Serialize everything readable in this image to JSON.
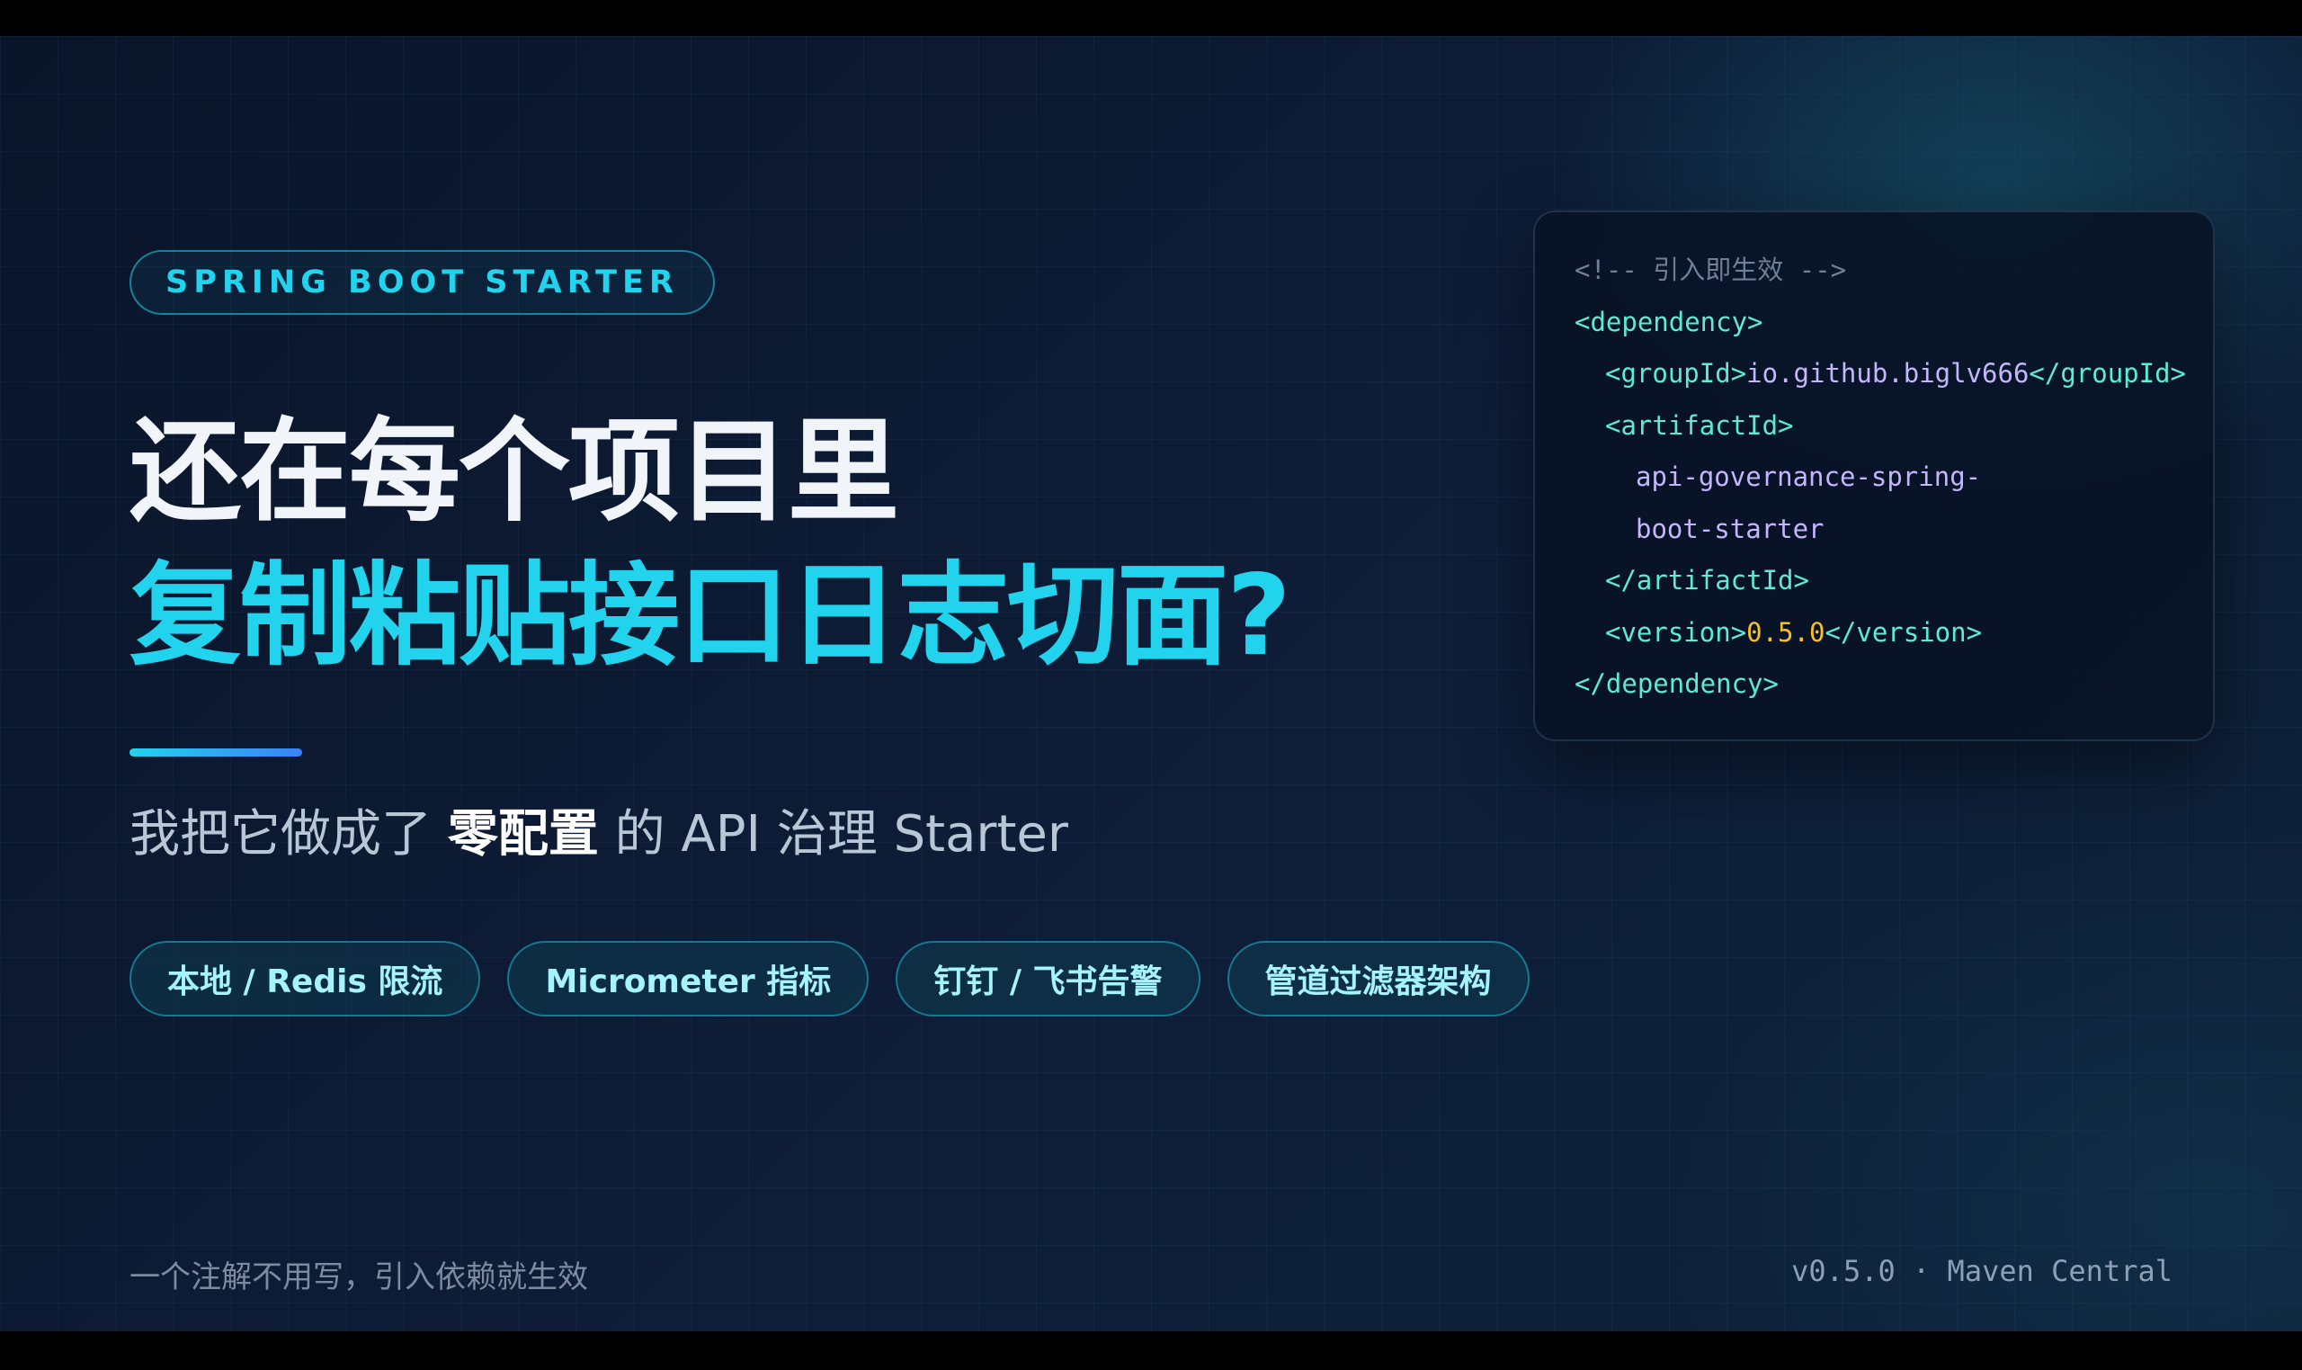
{
  "eyebrow": "SPRING BOOT STARTER",
  "headline": {
    "line1": "还在每个项目里",
    "line2": "复制粘贴接口日志切面?"
  },
  "subtitle": {
    "prefix": "我把它做成了 ",
    "emphasis": "零配置",
    "suffix": " 的 API 治理 Starter"
  },
  "pills": [
    "本地 / Redis 限流",
    "Micrometer 指标",
    "钉钉 / 飞书告警",
    "管道过滤器架构"
  ],
  "code": {
    "comment": "<!-- 引入即生效 -->",
    "dependency_open": "<dependency>",
    "group_open": "<groupId>",
    "group_value": "io.github.biglv666",
    "group_close": "</groupId>",
    "artifact_open": "<artifactId>",
    "artifact_value_line1": "api-governance-spring-",
    "artifact_value_line2": "boot-starter",
    "artifact_close": "</artifactId>",
    "version_open": "<version>",
    "version_value": "0.5.0",
    "version_close": "</version>",
    "dependency_close": "</dependency>"
  },
  "footer": {
    "left": "一个注解不用写，引入依赖就生效",
    "right": "v0.5.0 · Maven Central"
  },
  "colors": {
    "accent": "#22d3ee",
    "background": "#0b1830",
    "version_highlight": "#fbbf24"
  }
}
